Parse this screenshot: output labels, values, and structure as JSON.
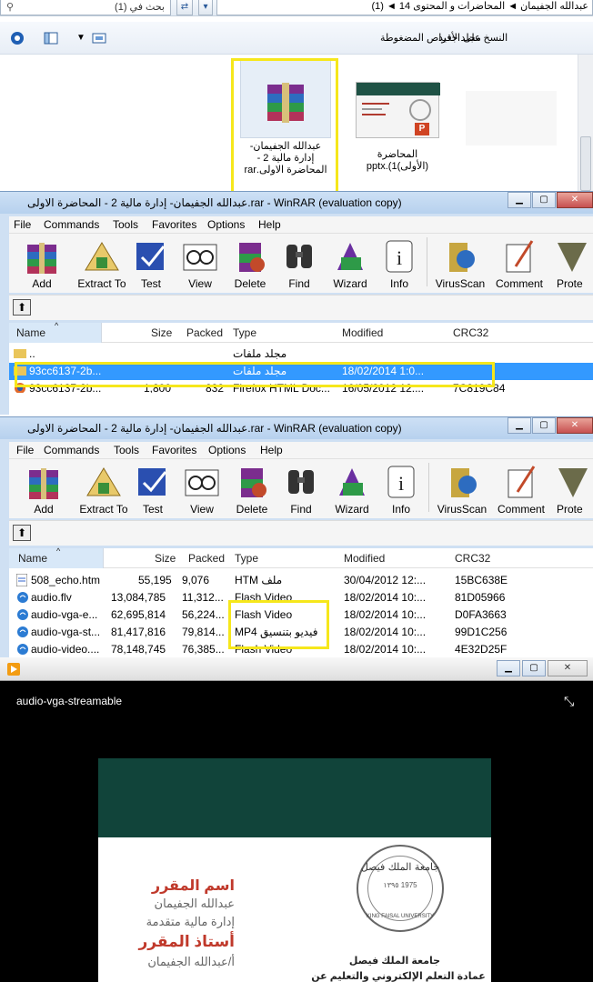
{
  "explorer": {
    "search_placeholder": "بحث في (1)",
    "breadcrumb": "عبدالله الجفيمان ◄ المحاضرات و المحتوى 14 ◄ (1)",
    "toolbar": {
      "new_folder": "مجلد جديد",
      "burn": "النسخ على الأقراص المضغوطة"
    },
    "files": [
      {
        "label": "عبدالله الجفيمان- إدارة مالية 2 - المحاضرة الاولى.rar",
        "icon": "rar-icon",
        "highlighted": true
      },
      {
        "label": "المحاضرة (الأولى)1).pptx",
        "icon": "pptx-icon",
        "highlighted": false
      }
    ]
  },
  "rar_common": {
    "menu": [
      "File",
      "Commands",
      "Tools",
      "Favorites",
      "Options",
      "Help"
    ],
    "tools": [
      "Add",
      "Extract To",
      "Test",
      "View",
      "Delete",
      "Find",
      "Wizard",
      "Info",
      "VirusScan",
      "Comment",
      "Prote"
    ],
    "columns": [
      "Name",
      "Size",
      "Packed",
      "Type",
      "Modified",
      "CRC32"
    ]
  },
  "rar1": {
    "title": "عبدالله الجفيمان- إدارة مالية 2 - المحاضرة الاولى.rar - WinRAR (evaluation copy)",
    "rows": [
      {
        "name": "..",
        "size": "",
        "packed": "",
        "type": "مجلد ملفات",
        "modified": "",
        "crc": "",
        "icon": "folder-up",
        "selected": false
      },
      {
        "name": "93cc6137-2b...",
        "size": "",
        "packed": "",
        "type": "مجلد ملفات",
        "modified": "18/02/2014 1:0...",
        "crc": "",
        "icon": "folder",
        "selected": true
      },
      {
        "name": "93cc6137-2b...",
        "size": "1,800",
        "packed": "832",
        "type": "Firefox HTML Doc...",
        "modified": "16/05/2012 12:...",
        "crc": "7C819C84",
        "icon": "firefox",
        "selected": false
      }
    ]
  },
  "rar2": {
    "title": "عبدالله الجفيمان- إدارة مالية 2 - المحاضرة الاولى.rar - WinRAR (evaluation copy)",
    "rows": [
      {
        "name": "508_echo.htm",
        "size": "55,195",
        "packed": "9,076",
        "type": "HTM ملف",
        "modified": "30/04/2012 12:...",
        "crc": "15BC638E",
        "icon": "htm"
      },
      {
        "name": "audio.flv",
        "size": "13,084,785",
        "packed": "11,312...",
        "type": "Flash Video",
        "modified": "18/02/2014 10:...",
        "crc": "81D05966",
        "icon": "video"
      },
      {
        "name": "audio-vga-e...",
        "size": "62,695,814",
        "packed": "56,224...",
        "type": "Flash Video",
        "modified": "18/02/2014 10:...",
        "crc": "D0FA3663",
        "icon": "video"
      },
      {
        "name": "audio-vga-st...",
        "size": "81,417,816",
        "packed": "79,814...",
        "type": "MP4 فيديو بتنسيق",
        "modified": "18/02/2014 10:...",
        "crc": "99D1C256",
        "icon": "video"
      },
      {
        "name": "audio-video....",
        "size": "78,148,745",
        "packed": "76,385...",
        "type": "Flash Video",
        "modified": "18/02/2014 10:...",
        "crc": "4E32D25F",
        "icon": "video"
      }
    ]
  },
  "player": {
    "video_name": "audio-vga-streamable",
    "slide": {
      "course_label": "اسم المقرر",
      "instructor_name": "عبدالله الجفيمان",
      "course_name": "إدارة مالية متقدمة",
      "teacher_label": "أستاذ المقرر",
      "teacher_name": "أ/عبدالله الجفيمان",
      "university": "جامعة الملك فيصل",
      "deanship": "عمادة التعلم الإلكتروني والتعليم عن بعد",
      "logo_text": "جامعة الملك فيصل",
      "logo_years": "١٣٩٥ 1975",
      "logo_en": "KING FAISAL UNIVERSITY"
    }
  },
  "colors": {
    "highlight": "#f6e71b",
    "selection": "#3399ff",
    "slide_green": "#11443a",
    "slide_red": "#c0392b"
  }
}
